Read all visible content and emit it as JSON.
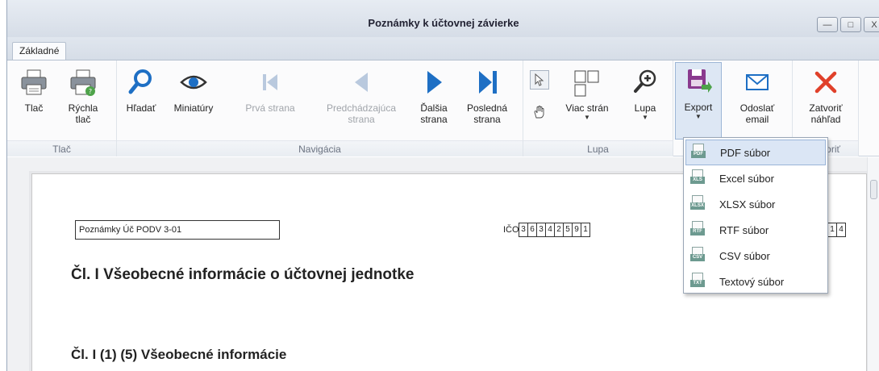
{
  "window": {
    "title": "Poznámky k účtovnej závierke",
    "controls": [
      "minimize",
      "maximize",
      "close"
    ]
  },
  "tabs": [
    {
      "label": "Základné",
      "active": true
    }
  ],
  "ribbon": {
    "groups": {
      "print": {
        "label": "Tlač",
        "buttons": [
          {
            "label": "Tlač",
            "icon": "printer-icon"
          },
          {
            "label": "Rýchla\ntlač",
            "icon": "quick-print-icon"
          }
        ]
      },
      "navigation": {
        "label": "Navigácia",
        "buttons": [
          {
            "label": "Hľadať",
            "icon": "search-icon",
            "enabled": true
          },
          {
            "label": "Miniatúry",
            "icon": "eye-icon",
            "enabled": true
          },
          {
            "label": "Prvá strana",
            "icon": "first-page-icon",
            "enabled": false
          },
          {
            "label": "Predchádzajúca\nstrana",
            "icon": "previous-page-icon",
            "enabled": false
          },
          {
            "label": "Ďalšia\nstrana",
            "icon": "next-page-icon",
            "enabled": true
          },
          {
            "label": "Posledná\nstrana",
            "icon": "last-page-icon",
            "enabled": true
          }
        ]
      },
      "zoom": {
        "label": "Lupa",
        "buttons": [
          {
            "label": "",
            "icon": "pointer-icon"
          },
          {
            "label": "",
            "icon": "hand-icon"
          },
          {
            "label": "Viac strán",
            "icon": "multiple-pages-icon"
          },
          {
            "label": "Lupa",
            "icon": "zoom-in-icon"
          }
        ]
      },
      "export": {
        "label": "Export",
        "buttons": [
          {
            "label": "Export",
            "icon": "export-icon",
            "active": true
          },
          {
            "label": "Odoslať\nemail",
            "icon": "email-icon"
          }
        ]
      },
      "close": {
        "label": "Zatvoriť",
        "label_visible": "voriť",
        "buttons": [
          {
            "label": "Zatvoriť\nnáhľad",
            "icon": "close-icon"
          }
        ]
      }
    }
  },
  "document": {
    "box_text": "Poznámky Úč PODV 3-01",
    "ico_label": "IČO",
    "ico_digits": [
      "3",
      "6",
      "3",
      "4",
      "2",
      "5",
      "9",
      "1"
    ],
    "right_digits": [
      "0",
      "1",
      "4"
    ],
    "heading1": "Čl. I Všeobecné informácie o účtovnej jednotke",
    "heading2": "Čl. I (1) (5) Všeobecné informácie"
  },
  "export_menu": {
    "items": [
      {
        "label": "PDF súbor",
        "tag": "PDF",
        "selected": true
      },
      {
        "label": "Excel súbor",
        "tag": "XLS",
        "selected": false
      },
      {
        "label": "XLSX súbor",
        "tag": "XLSX",
        "selected": false
      },
      {
        "label": "RTF súbor",
        "tag": "RTF",
        "selected": false
      },
      {
        "label": "CSV súbor",
        "tag": "CSV",
        "selected": false
      },
      {
        "label": "Textový súbor",
        "tag": "TXT",
        "selected": false
      }
    ]
  },
  "colors": {
    "accent_blue": "#1e6fc4",
    "close_red": "#e0402a",
    "export_purple": "#8a3a8e",
    "green": "#4ea34a"
  }
}
